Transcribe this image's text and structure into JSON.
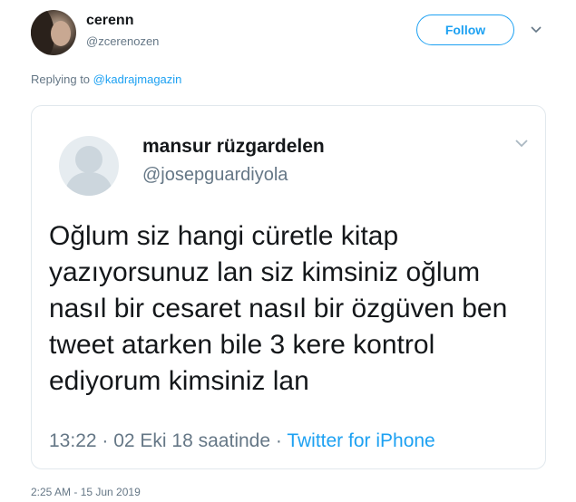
{
  "tweet": {
    "author_name": "cerenn",
    "author_handle": "@zcerenozen",
    "follow_label": "Follow",
    "replying_prefix": "Replying to ",
    "replying_handle": "@kadrajmagazin",
    "timestamp": "2:25 AM - 15 Jun 2019"
  },
  "quoted": {
    "author_name": "mansur rüzgardelen",
    "author_handle": "@josepguardiyola",
    "text": "Oğlum siz hangi cüretle kitap yazıyorsunuz lan siz kimsiniz oğlum nasıl bir cesaret nasıl bir özgüven ben tweet atarken bile 3 kere kontrol ediyorum kimsiniz lan",
    "time": "13:22",
    "sep1": " · ",
    "date": "02 Eki 18 saatinde",
    "sep2": " · ",
    "source": "Twitter for iPhone"
  },
  "colors": {
    "accent": "#1da1f2",
    "secondary_text": "#657786",
    "border": "#e1e8ed"
  },
  "icons": {
    "menu": "chevron-down-icon",
    "default_avatar": "default-avatar-icon"
  }
}
